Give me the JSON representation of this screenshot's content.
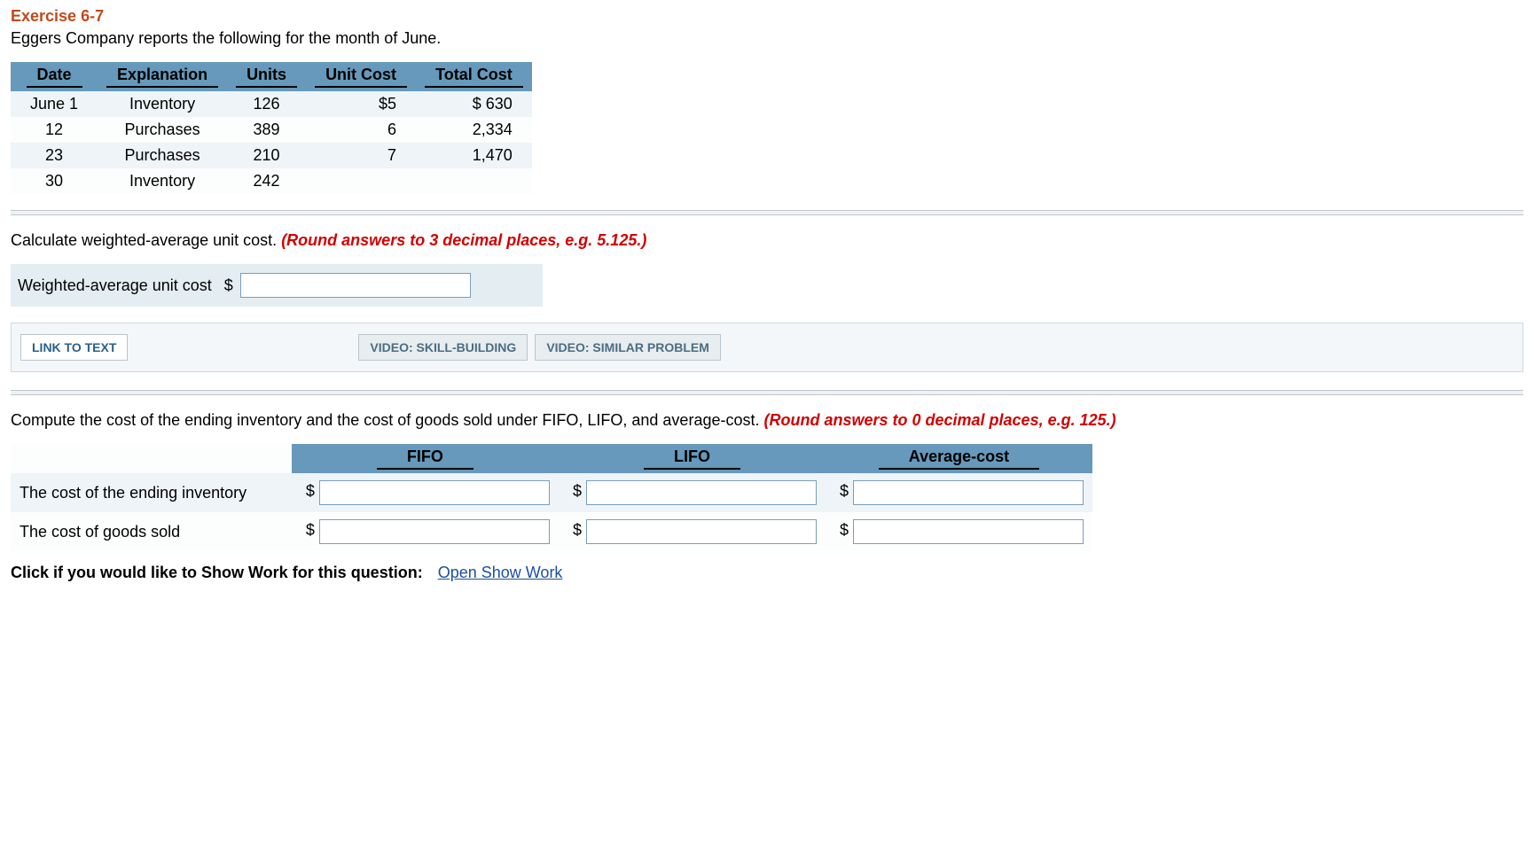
{
  "title": "Exercise 6-7",
  "intro": "Eggers Company reports the following for the month of June.",
  "table": {
    "headers": [
      "Date",
      "Explanation",
      "Units",
      "Unit Cost",
      "Total Cost"
    ],
    "rows": [
      {
        "date": "June 1",
        "expl": "Inventory",
        "units": "126",
        "unit_cost": "$5",
        "total": "$ 630"
      },
      {
        "date": "12",
        "expl": "Purchases",
        "units": "389",
        "unit_cost": "6",
        "total": "2,334"
      },
      {
        "date": "23",
        "expl": "Purchases",
        "units": "210",
        "unit_cost": "7",
        "total": "1,470"
      },
      {
        "date": "30",
        "expl": "Inventory",
        "units": "242",
        "unit_cost": "",
        "total": ""
      }
    ]
  },
  "part1": {
    "instruction_plain": "Calculate weighted-average unit cost. ",
    "instruction_hint": "(Round answers to 3 decimal places, e.g. 5.125.)",
    "label": "Weighted-average unit cost",
    "currency": "$"
  },
  "links": {
    "link_to_text": "LINK TO TEXT",
    "video1": "VIDEO: SKILL-BUILDING",
    "video2": "VIDEO: SIMILAR PROBLEM"
  },
  "part2": {
    "instruction_plain": "Compute the cost of the ending inventory and the cost of goods sold under FIFO, LIFO, and average-cost. ",
    "instruction_hint": "(Round answers to 0 decimal places, e.g. 125.)",
    "col_headers": [
      "FIFO",
      "LIFO",
      "Average-cost"
    ],
    "rows": [
      {
        "label": "The cost of the ending inventory"
      },
      {
        "label": "The cost of goods sold"
      }
    ],
    "currency": "$"
  },
  "show_work": {
    "prefix": "Click if you would like to Show Work for this question:",
    "link": "Open Show Work"
  }
}
